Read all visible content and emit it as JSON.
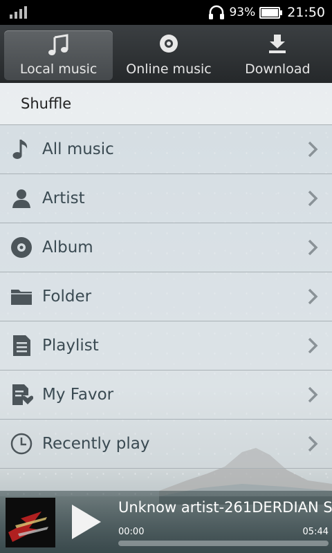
{
  "status_bar": {
    "battery": "93%",
    "battery_level": 0.93,
    "time": "21:50"
  },
  "tabs": [
    {
      "label": "Local music",
      "icon": "music-note-icon",
      "active": true
    },
    {
      "label": "Online music",
      "icon": "disc-icon",
      "active": false
    },
    {
      "label": "Download",
      "icon": "download-icon",
      "active": false
    }
  ],
  "shuffle_label": "Shuffle",
  "menu": [
    {
      "label": "All music",
      "icon": "music-note-icon"
    },
    {
      "label": "Artist",
      "icon": "person-icon"
    },
    {
      "label": "Album",
      "icon": "disc-icon"
    },
    {
      "label": "Folder",
      "icon": "folder-icon"
    },
    {
      "label": "Playlist",
      "icon": "playlist-icon"
    },
    {
      "label": "My Favor",
      "icon": "favorite-list-icon"
    },
    {
      "label": "Recently play",
      "icon": "clock-icon"
    }
  ],
  "player": {
    "title": "Unknow artist-261DERDIAN S",
    "elapsed": "00:00",
    "duration": "05:44",
    "progress": 0.0
  },
  "colors": {
    "icon_gray": "#4c555a",
    "chevron_gray": "#8a9297",
    "tab_bar": "#2b2e30"
  }
}
